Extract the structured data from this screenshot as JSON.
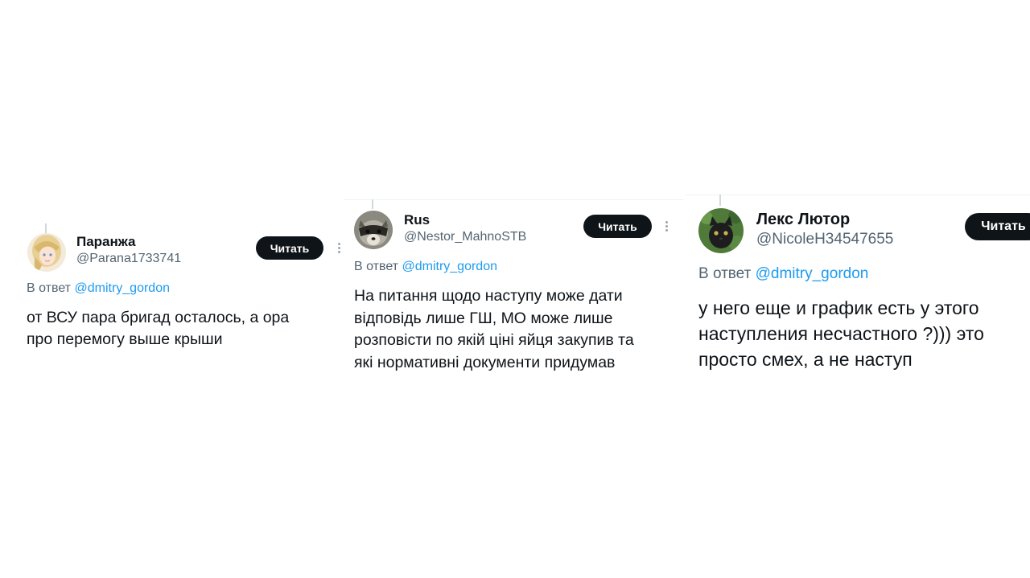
{
  "tweets": [
    {
      "name": "Паранжа",
      "handle": "@Parana1733741",
      "button": "Читать",
      "reply_prefix": "В ответ",
      "reply_to": "@dmitry_gordon",
      "lines": [
        "от ВСУ пара бригад осталось, а ора",
        "про перемогу выше крыши"
      ]
    },
    {
      "name": "Rus",
      "handle": "@Nestor_MahnoSTB",
      "button": "Читать",
      "reply_prefix": "В ответ",
      "reply_to": "@dmitry_gordon",
      "lines": [
        "На питання щодо наступу може дати",
        "відповідь лише ГШ, МО може лише",
        "розповісти по якій ціні яйця закупив та",
        "які нормативні документи придумав"
      ]
    },
    {
      "name": "Лекс Лютор",
      "handle": "@NicoleH34547655",
      "button": "Читать",
      "reply_prefix": "В ответ",
      "reply_to": "@dmitry_gordon",
      "lines": [
        "у него еще и график есть у этого",
        "наступления несчастного ?))) это",
        "просто смех, а не наступ"
      ]
    }
  ]
}
